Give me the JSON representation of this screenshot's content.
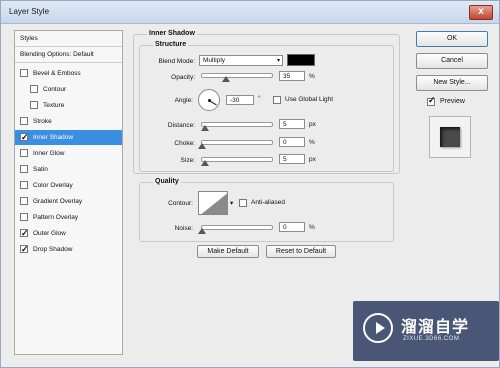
{
  "window": {
    "title": "Layer Style",
    "close_glyph": "x"
  },
  "style_list": {
    "header": "Styles",
    "blending": "Blending Options: Default",
    "items": [
      {
        "label": "Bevel & Emboss",
        "checked": false
      },
      {
        "label": "Contour",
        "checked": false
      },
      {
        "label": "Texture",
        "checked": false
      },
      {
        "label": "Stroke",
        "checked": false
      },
      {
        "label": "Inner Shadow",
        "checked": true
      },
      {
        "label": "Inner Glow",
        "checked": false
      },
      {
        "label": "Satin",
        "checked": false
      },
      {
        "label": "Color Overlay",
        "checked": false
      },
      {
        "label": "Gradient Overlay",
        "checked": false
      },
      {
        "label": "Pattern Overlay",
        "checked": false
      },
      {
        "label": "Outer Glow",
        "checked": true
      },
      {
        "label": "Drop Shadow",
        "checked": true
      }
    ]
  },
  "panel": {
    "title": "Inner Shadow",
    "structure": {
      "legend": "Structure",
      "blend_mode_label": "Blend Mode:",
      "blend_mode_value": "Multiply",
      "color": "#000000",
      "opacity_label": "Opacity:",
      "opacity_value": "35",
      "opacity_unit": "%",
      "angle_label": "Angle:",
      "angle_value": "-30",
      "angle_unit": "°",
      "global_light_label": "Use Global Light",
      "distance_label": "Distance:",
      "distance_value": "5",
      "distance_unit": "px",
      "choke_label": "Choke:",
      "choke_value": "0",
      "choke_unit": "%",
      "size_label": "Size:",
      "size_value": "5",
      "size_unit": "px"
    },
    "quality": {
      "legend": "Quality",
      "contour_label": "Contour:",
      "anti_aliased_label": "Anti-aliased",
      "noise_label": "Noise:",
      "noise_value": "0",
      "noise_unit": "%"
    },
    "make_default": "Make Default",
    "reset_default": "Reset to Default"
  },
  "actions": {
    "ok": "OK",
    "cancel": "Cancel",
    "new_style": "New Style...",
    "preview_label": "Preview"
  },
  "watermark": {
    "title": "溜溜自学",
    "url": "ZIXUE.3D66.COM"
  }
}
